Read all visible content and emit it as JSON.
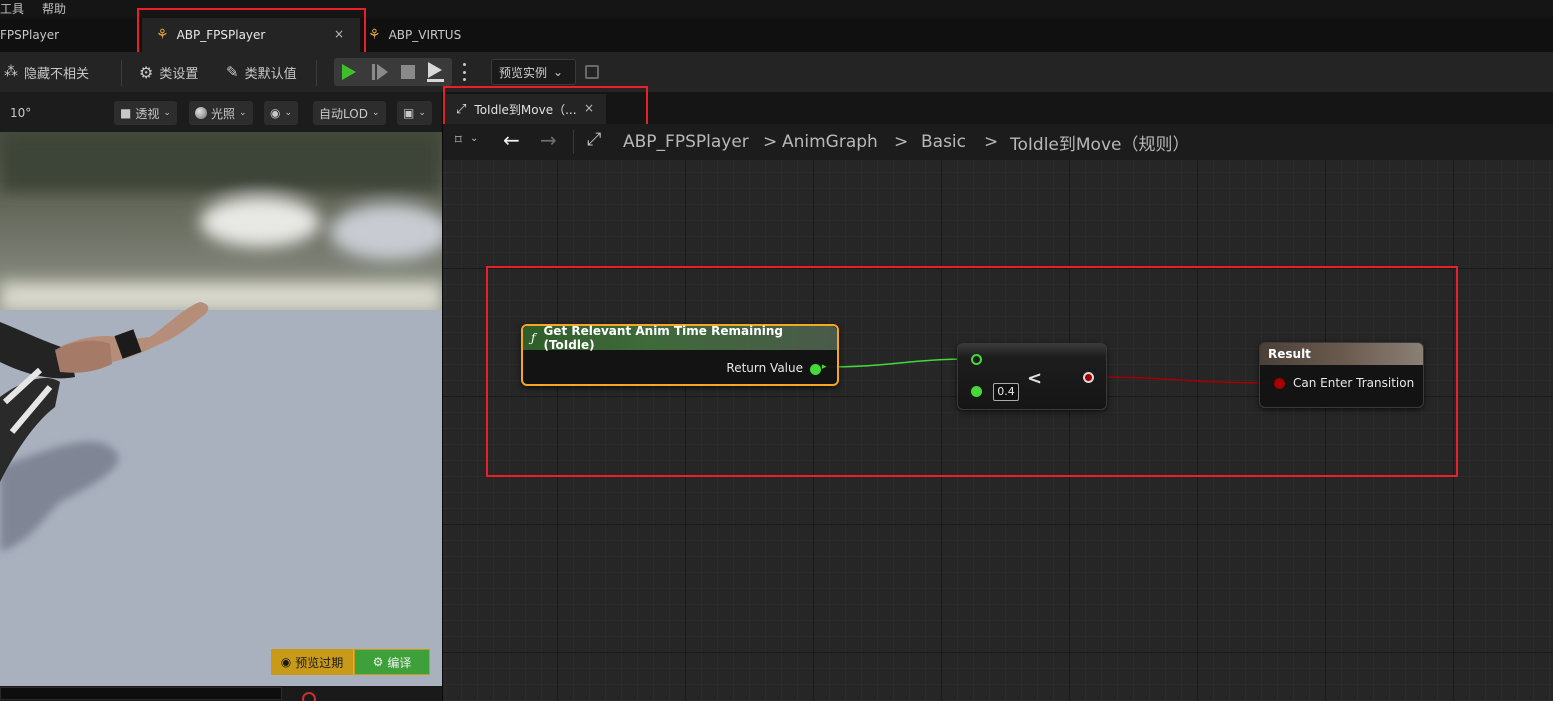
{
  "menu": {
    "tools": "工具",
    "help": "帮助"
  },
  "tabs": [
    {
      "label": "FPSPlayer"
    },
    {
      "label": "ABP_FPSPlayer",
      "close": "×"
    },
    {
      "label": "ABP_VIRTUS"
    }
  ],
  "toolbar": {
    "hide_unrelated": "隐藏不相关",
    "class_settings": "类设置",
    "class_defaults": "类默认值",
    "preview_instance": "预览实例"
  },
  "viewport": {
    "fov": "10°",
    "perspective": "透视",
    "lit": "光照",
    "auto_lod": "自动LOD",
    "preview_expired": "预览过期",
    "compile": "编译"
  },
  "graph": {
    "tab_label": "ToIdle到Move（...",
    "tab_close": "×",
    "breadcrumbs": [
      "ABP_FPSPlayer",
      "AnimGraph",
      "Basic",
      "ToIdle到Move（规则）"
    ],
    "crumb_sep": ">",
    "nodes": {
      "get_time": {
        "title": "Get Relevant Anim Time Remaining (ToIdle)",
        "return_label": "Return Value"
      },
      "compare": {
        "operator": "<",
        "value": "0.4"
      },
      "result": {
        "title": "Result",
        "pin_label": "Can Enter Transition"
      }
    }
  },
  "colors": {
    "function_header": "#2f5e2a",
    "selected_outline": "#f5a623",
    "float_pin": "#44d838",
    "bool_pin": "#a20000",
    "highlight_box": "#e8202a",
    "play_green": "#3fbf2a"
  }
}
